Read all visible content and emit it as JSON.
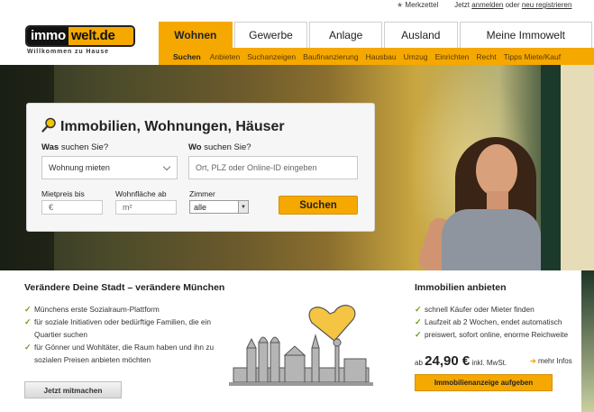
{
  "utility_bar": {
    "bookmarks": "Merkzettel",
    "prefix": "Jetzt",
    "login": "anmelden",
    "or": "oder",
    "register": "neu registrieren"
  },
  "logo": {
    "part1": "immo",
    "part2": "welt.de",
    "tagline": "Willkommen zu Hause"
  },
  "nav": {
    "tabs": [
      {
        "label": "Wohnen",
        "active": true
      },
      {
        "label": "Gewerbe"
      },
      {
        "label": "Anlage"
      },
      {
        "label": "Ausland"
      },
      {
        "label": "Meine Immowelt"
      }
    ],
    "subnav": [
      "Suchen",
      "Anbieten",
      "Suchanzeigen",
      "Baufinanzierung",
      "Hausbau",
      "Umzug",
      "Einrichten",
      "Recht",
      "Tipps Miete/Kauf"
    ]
  },
  "search": {
    "title": "Immobilien, Wohnungen, Häuser",
    "was_label_bold": "Was",
    "was_label_rest": " suchen Sie?",
    "was_value": "Wohnung mieten",
    "wo_label_bold": "Wo",
    "wo_label_rest": " suchen Sie?",
    "wo_placeholder": "Ort, PLZ oder Online-ID eingeben",
    "mietpreis_label": "Mietpreis bis",
    "mietpreis_placeholder": "€",
    "wohnflaeche_label": "Wohnfläche ab",
    "wohnflaeche_placeholder": "m²",
    "zimmer_label": "Zimmer",
    "zimmer_value": "alle",
    "button": "Suchen"
  },
  "left_panel": {
    "title": "Verändere Deine Stadt – verändere München",
    "bullets": [
      "Münchens erste Sozialraum-Plattform",
      "für soziale Initiativen oder bedürftige Familien, die ein Quartier suchen",
      "für Gönner und Wohltäter, die Raum haben und ihn zu sozialen Preisen anbieten möchten"
    ],
    "button": "Jetzt mitmachen"
  },
  "right_panel": {
    "title": "Immobilien anbieten",
    "bullets": [
      "schnell Käufer oder Mieter finden",
      "Laufzeit ab 2 Wochen, endet automatisch",
      "preiswert, sofort online, enorme Reichweite"
    ],
    "price_prefix": "ab",
    "price": "24,90 €",
    "price_suffix": "inkl. MwSt.",
    "more": "mehr Infos",
    "button": "Immobilienanzeige aufgeben"
  },
  "colors": {
    "accent": "#f5a800",
    "check": "#6a9c1a"
  }
}
